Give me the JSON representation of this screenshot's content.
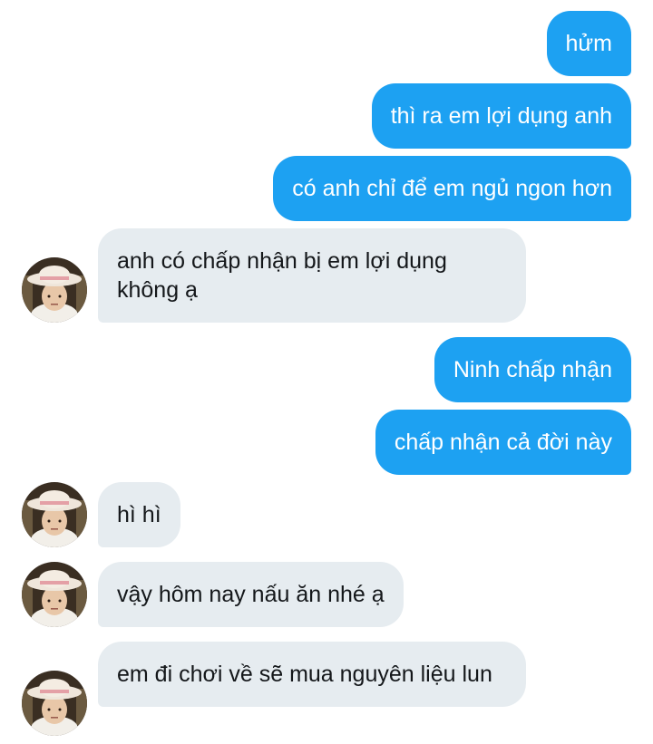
{
  "conversation": {
    "messages": [
      {
        "direction": "outgoing",
        "text": "hửm"
      },
      {
        "direction": "outgoing",
        "text": "thì ra em lợi dụng anh"
      },
      {
        "direction": "outgoing",
        "text": "có anh chỉ để em ngủ ngon hơn"
      },
      {
        "direction": "incoming",
        "text": "anh có chấp nhận bị em lợi dụng không ạ",
        "avatar": "contact-avatar"
      },
      {
        "direction": "outgoing",
        "text": "Ninh chấp nhận"
      },
      {
        "direction": "outgoing",
        "text": "chấp nhận cả đời này"
      },
      {
        "direction": "incoming",
        "text": "hì hì",
        "avatar": "contact-avatar"
      },
      {
        "direction": "incoming",
        "text": "vậy hôm nay nấu ăn nhé ạ",
        "avatar": "contact-avatar"
      },
      {
        "direction": "incoming",
        "text": "em đi chơi về sẽ mua nguyên liệu lun",
        "avatar": "contact-avatar"
      }
    ]
  },
  "colors": {
    "outgoing_bubble": "#1da1f2",
    "incoming_bubble": "#e6ecf0",
    "outgoing_text": "#ffffff",
    "incoming_text": "#14171a",
    "background": "#ffffff"
  }
}
